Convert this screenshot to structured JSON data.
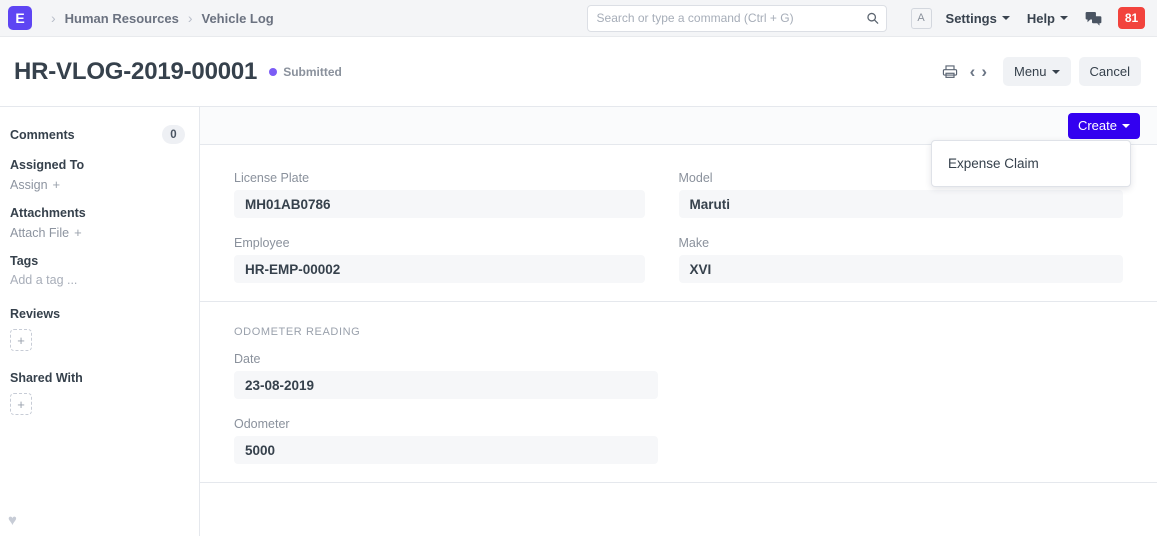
{
  "navbar": {
    "logo_letter": "E",
    "breadcrumbs": [
      "Human Resources",
      "Vehicle Log"
    ],
    "search_placeholder": "Search or type a command (Ctrl + G)",
    "search_value": "",
    "avatar_letter": "A",
    "settings_label": "Settings",
    "help_label": "Help",
    "notification_count": "81",
    "notification_color": "#f2433d",
    "brand_color": "#5e45f3"
  },
  "titlebar": {
    "doc_title": "HR-VLOG-2019-00001",
    "status": "Submitted",
    "status_color": "#7b5cf5",
    "menu_label": "Menu",
    "cancel_label": "Cancel"
  },
  "sidebar": {
    "comments": {
      "label": "Comments",
      "count": "0"
    },
    "assigned_to": {
      "label": "Assigned To",
      "action": "Assign"
    },
    "attachments": {
      "label": "Attachments",
      "action": "Attach File"
    },
    "tags": {
      "label": "Tags",
      "placeholder": "Add a tag ..."
    },
    "reviews": {
      "label": "Reviews",
      "add": "+"
    },
    "shared_with": {
      "label": "Shared With",
      "add": "+"
    },
    "like_icon": "♥"
  },
  "toolbar": {
    "create_label": "Create",
    "create_color": "#3300f0",
    "dropdown_items": [
      "Expense Claim"
    ]
  },
  "form": {
    "section1": {
      "left": [
        {
          "label": "License Plate",
          "value": "MH01AB0786"
        },
        {
          "label": "Employee",
          "value": "HR-EMP-00002"
        }
      ],
      "right": [
        {
          "label": "Model",
          "value": "Maruti"
        },
        {
          "label": "Make",
          "value": "XVI"
        }
      ]
    },
    "section2": {
      "title": "ODOMETER READING",
      "fields": [
        {
          "label": "Date",
          "value": "23-08-2019"
        },
        {
          "label": "Odometer",
          "value": "5000"
        }
      ]
    }
  }
}
